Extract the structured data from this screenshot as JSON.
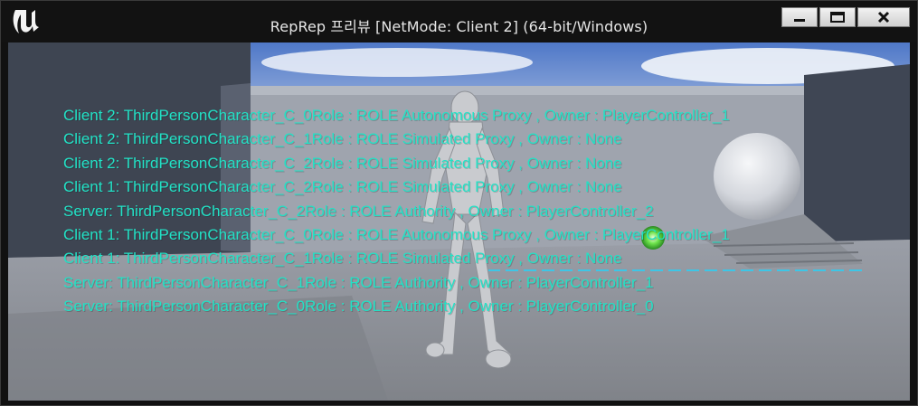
{
  "window": {
    "title": "RepRep 프리뷰 [NetMode: Client 2]  (64-bit/Windows)",
    "app_icon": "unreal-engine-logo-icon",
    "controls": {
      "minimize_icon": "minimize-icon",
      "maximize_icon": "maximize-icon",
      "close_icon": "close-icon"
    }
  },
  "viewport": {
    "debug_text_color": "#22e2c6",
    "debug_lines": [
      "Client 2: ThirdPersonCharacter_C_0Role : ROLE Autonomous Proxy , Owner : PlayerController_1",
      "Client 2: ThirdPersonCharacter_C_1Role : ROLE Simulated Proxy , Owner : None",
      "Client 2: ThirdPersonCharacter_C_2Role : ROLE Simulated Proxy , Owner : None",
      "Client 1: ThirdPersonCharacter_C_2Role : ROLE Simulated Proxy , Owner : None",
      "Server: ThirdPersonCharacter_C_2Role : ROLE Authority , Owner : PlayerController_2",
      "Client 1: ThirdPersonCharacter_C_0Role : ROLE Autonomous Proxy , Owner : PlayerController_1",
      "Client 1: ThirdPersonCharacter_C_1Role : ROLE Simulated Proxy , Owner : None",
      "Server: ThirdPersonCharacter_C_1Role : ROLE Authority , Owner : PlayerController_1",
      "Server: ThirdPersonCharacter_C_0Role : ROLE Authority , Owner : PlayerController_0"
    ]
  }
}
